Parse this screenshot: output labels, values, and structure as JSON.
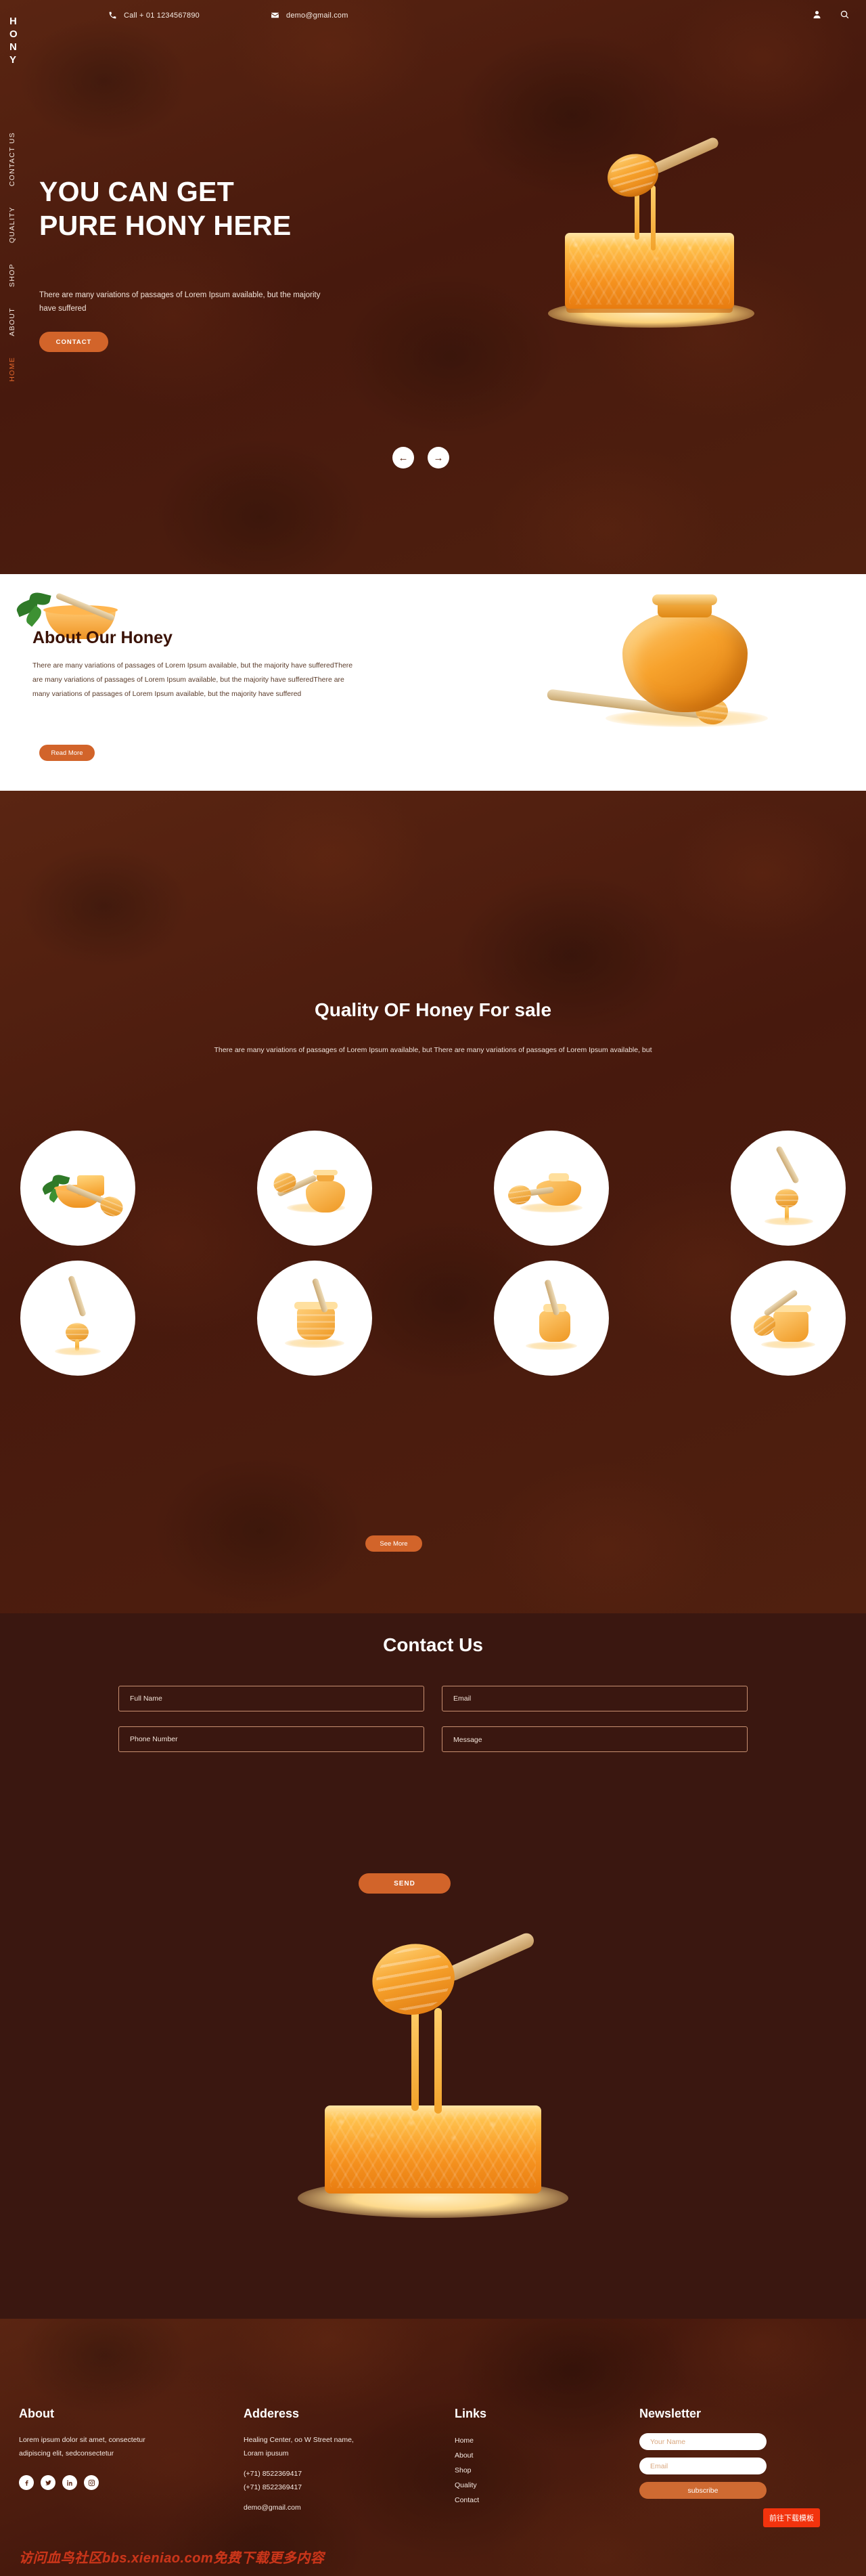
{
  "topbar": {
    "phone_label": "Call + 01 1234567890",
    "email_label": "demo@gmail.com",
    "account_icon": "user-icon",
    "search_icon": "search-icon"
  },
  "logo": {
    "lines": [
      "H",
      "O",
      "N",
      "Y"
    ]
  },
  "sidenav": {
    "items": [
      {
        "label": "CONTACT US",
        "active": false
      },
      {
        "label": "QUALITY",
        "active": false
      },
      {
        "label": "SHOP",
        "active": false
      },
      {
        "label": "ABOUT",
        "active": false
      },
      {
        "label": "HOME",
        "active": true
      }
    ]
  },
  "hero": {
    "title_line1": "YOU CAN GET",
    "title_line2": "PURE HONY HERE",
    "subtitle": "There are many variations of passages of Lorem Ipsum available, but the majority have suffered",
    "cta_label": "CONTACT",
    "prev_icon": "arrow-left-icon",
    "next_icon": "arrow-right-icon"
  },
  "about": {
    "title": "About Our Honey",
    "body": "There are many variations of passages of Lorem Ipsum available, but the majority have sufferedThere are many variations of passages of Lorem Ipsum available, but the majority have sufferedThere are many variations of passages of Lorem Ipsum available, but the majority have suffered",
    "cta_label": "Read More"
  },
  "quality": {
    "title": "Quality OF Honey For sale",
    "subtitle": "There are many variations of passages of Lorem Ipsum available, but There are many variations of passages of Lorem Ipsum available, but",
    "cta_label": "See More",
    "products": [
      {
        "name": "honey-bowl-with-mint-and-comb"
      },
      {
        "name": "honey-jar-with-dipper"
      },
      {
        "name": "honey-jar-wide-with-dipper"
      },
      {
        "name": "honey-dipper-dripping"
      },
      {
        "name": "honey-dipper-pouring"
      },
      {
        "name": "honey-jar-striped-with-dipper"
      },
      {
        "name": "tall-honey-jar-with-dipper"
      },
      {
        "name": "honey-jar-open-with-dipper"
      }
    ]
  },
  "contact": {
    "title": "Contact Us",
    "fields": {
      "full_name_placeholder": "Full Name",
      "email_placeholder": "Email",
      "phone_placeholder": "Phone Number",
      "message_placeholder": "Message"
    },
    "send_label": "SEND"
  },
  "footer": {
    "about": {
      "heading": "About",
      "body": "Lorem ipsum dolor sit amet, consectetur adipiscing elit, sedconsectetur",
      "socials": [
        {
          "name": "facebook-icon"
        },
        {
          "name": "twitter-icon"
        },
        {
          "name": "linkedin-icon"
        },
        {
          "name": "instagram-icon"
        }
      ]
    },
    "address": {
      "heading": "Adderess",
      "line1": "Healing Center, oo W Street name,",
      "line2": "Loram ipusum",
      "phone1": "(+71) 8522369417",
      "phone2": "(+71) 8522369417",
      "email": "demo@gmail.com"
    },
    "links": {
      "heading": "Links",
      "items": [
        "Home",
        "About",
        "Shop",
        "Quality",
        "Contact"
      ]
    },
    "newsletter": {
      "heading": "Newsletter",
      "name_placeholder": "Your Name",
      "email_placeholder": "Email",
      "subscribe_label": "subscribe"
    },
    "download_badge": "前往下载模板",
    "watermark": "访问血鸟社区bbs.xieniao.com免费下载更多内容"
  },
  "colors": {
    "brand_brown": "#50200f",
    "accent_orange": "#d2642a",
    "nav_active": "#e0662b",
    "badge_red": "#f2330d"
  }
}
